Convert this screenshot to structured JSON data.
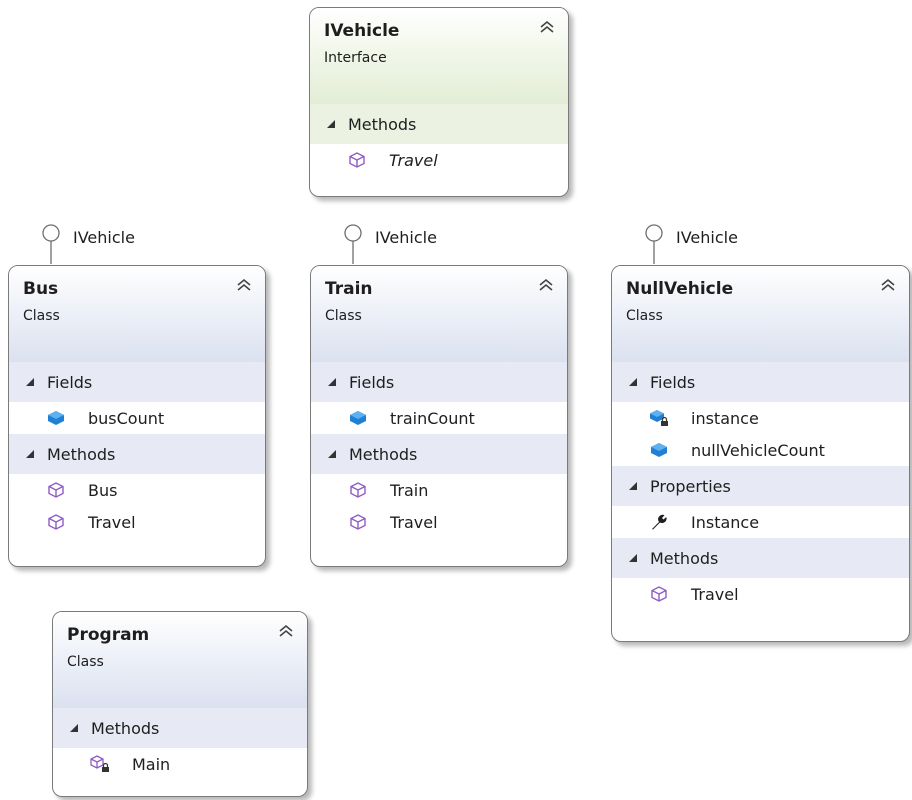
{
  "diagram": {
    "ivehicle": {
      "name": "IVehicle",
      "kind": "Interface",
      "sections": [
        {
          "label": "Methods",
          "members": [
            {
              "name": "Travel",
              "icon": "method-icon",
              "italic": true
            }
          ]
        }
      ]
    },
    "lollipops": {
      "bus": "IVehicle",
      "train": "IVehicle",
      "nullvehicle": "IVehicle"
    },
    "bus": {
      "name": "Bus",
      "kind": "Class",
      "sections": [
        {
          "label": "Fields",
          "members": [
            {
              "name": "busCount",
              "icon": "field-icon"
            }
          ]
        },
        {
          "label": "Methods",
          "members": [
            {
              "name": "Bus",
              "icon": "method-icon"
            },
            {
              "name": "Travel",
              "icon": "method-icon"
            }
          ]
        }
      ]
    },
    "train": {
      "name": "Train",
      "kind": "Class",
      "sections": [
        {
          "label": "Fields",
          "members": [
            {
              "name": "trainCount",
              "icon": "field-icon"
            }
          ]
        },
        {
          "label": "Methods",
          "members": [
            {
              "name": "Train",
              "icon": "method-icon"
            },
            {
              "name": "Travel",
              "icon": "method-icon"
            }
          ]
        }
      ]
    },
    "nullvehicle": {
      "name": "NullVehicle",
      "kind": "Class",
      "sections": [
        {
          "label": "Fields",
          "members": [
            {
              "name": "instance",
              "icon": "private-field-icon"
            },
            {
              "name": "nullVehicleCount",
              "icon": "field-icon"
            }
          ]
        },
        {
          "label": "Properties",
          "members": [
            {
              "name": "Instance",
              "icon": "wrench-property-icon"
            }
          ]
        },
        {
          "label": "Methods",
          "members": [
            {
              "name": "Travel",
              "icon": "method-icon"
            }
          ]
        }
      ]
    },
    "program": {
      "name": "Program",
      "kind": "Class",
      "sections": [
        {
          "label": "Methods",
          "members": [
            {
              "name": "Main",
              "icon": "private-method-icon"
            }
          ]
        }
      ]
    }
  },
  "colors": {
    "class_header": "#dbe1f0",
    "interface_header": "#e3edd6",
    "field_icon": "#1f80d6",
    "method_icon": "#8f5cc4",
    "border": "#7a7a7a"
  }
}
